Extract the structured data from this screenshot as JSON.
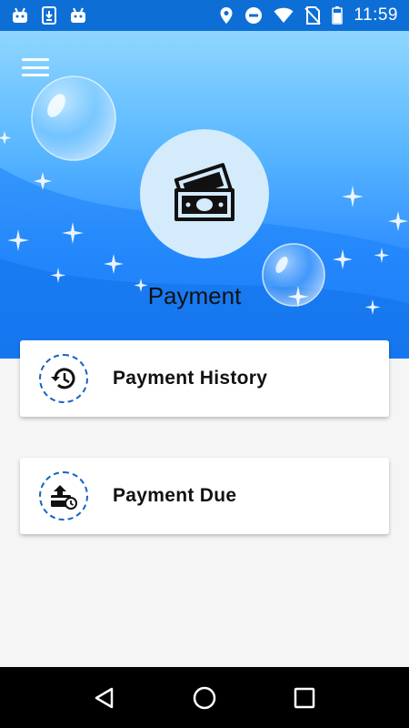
{
  "status_bar": {
    "time": "11:59",
    "left_icons": [
      "android-icon",
      "download-icon",
      "android-icon"
    ],
    "right_icons": [
      "location-icon",
      "do-not-disturb-icon",
      "wifi-icon",
      "no-sim-icon",
      "battery-icon"
    ]
  },
  "header": {
    "menu_icon": "menu-icon",
    "hero_icon": "money-icon",
    "title": "Payment"
  },
  "cards": [
    {
      "icon": "history-icon",
      "label": "Payment History"
    },
    {
      "icon": "payment-due-icon",
      "label": "Payment Due"
    }
  ],
  "nav_bar": {
    "items": [
      "back-icon",
      "home-icon",
      "recents-icon"
    ]
  },
  "colors": {
    "status_bar": "#0d6fd6",
    "header_top": "#8fd6ff",
    "header_bottom": "#1a7af5",
    "icon_ring": "#1565c0",
    "background": "#f5f5f5"
  }
}
